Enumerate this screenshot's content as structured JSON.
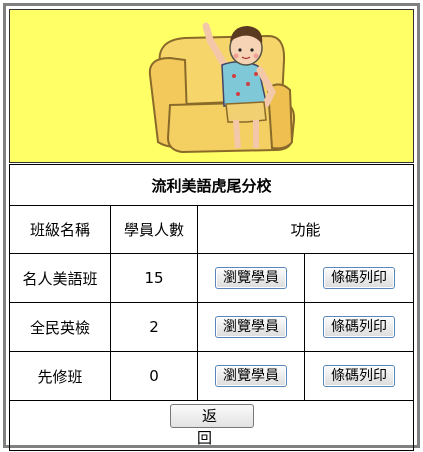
{
  "school": {
    "title": "流利美語虎尾分校"
  },
  "table": {
    "headers": {
      "class_name": "班級名稱",
      "student_count": "學員人數",
      "functions": "功能"
    },
    "rows": [
      {
        "class_name": "名人美語班",
        "count": "15",
        "browse_label": "瀏覽學員",
        "barcode_label": "條碼列印"
      },
      {
        "class_name": "全民英檢",
        "count": "2",
        "browse_label": "瀏覽學員",
        "barcode_label": "條碼列印"
      },
      {
        "class_name": "先修班",
        "count": "0",
        "browse_label": "瀏覽學員",
        "barcode_label": "條碼列印"
      }
    ]
  },
  "footer": {
    "back_label": "返 回"
  },
  "colors": {
    "banner_bg": "#ffff66",
    "frame_border": "#808080",
    "button_border": "#5a86b8"
  }
}
